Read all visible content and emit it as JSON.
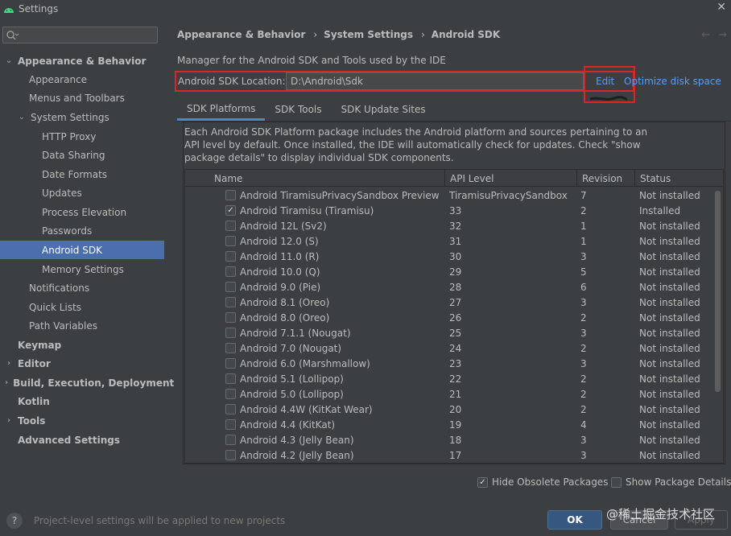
{
  "window": {
    "title": "Settings",
    "close": "✕"
  },
  "sidebar": {
    "search_placeholder": "",
    "items": [
      {
        "label": "Appearance & Behavior",
        "bold": true,
        "arrow": "⌄",
        "indent": 6
      },
      {
        "label": "Appearance",
        "indent": 36
      },
      {
        "label": "Menus and Toolbars",
        "indent": 36
      },
      {
        "label": "System Settings",
        "arrow": "⌄",
        "indent": 22
      },
      {
        "label": "HTTP Proxy",
        "indent": 52
      },
      {
        "label": "Data Sharing",
        "indent": 52
      },
      {
        "label": "Date Formats",
        "indent": 52
      },
      {
        "label": "Updates",
        "indent": 52
      },
      {
        "label": "Process Elevation",
        "indent": 52
      },
      {
        "label": "Passwords",
        "indent": 52
      },
      {
        "label": "Android SDK",
        "indent": 52,
        "selected": true
      },
      {
        "label": "Memory Settings",
        "indent": 52
      },
      {
        "label": "Notifications",
        "indent": 36
      },
      {
        "label": "Quick Lists",
        "indent": 36
      },
      {
        "label": "Path Variables",
        "indent": 36
      },
      {
        "label": "Keymap",
        "bold": true,
        "indent": 22
      },
      {
        "label": "Editor",
        "bold": true,
        "arrow": "›",
        "indent": 6
      },
      {
        "label": "Build, Execution, Deployment",
        "bold": true,
        "arrow": "›",
        "indent": 6
      },
      {
        "label": "Kotlin",
        "bold": true,
        "indent": 22
      },
      {
        "label": "Tools",
        "bold": true,
        "arrow": "›",
        "indent": 6
      },
      {
        "label": "Advanced Settings",
        "bold": true,
        "indent": 22
      }
    ]
  },
  "breadcrumb": {
    "part1": "Appearance & Behavior",
    "sep": "›",
    "part2": "System Settings",
    "part3": "Android SDK",
    "back": "←",
    "forward": "→"
  },
  "description": "Manager for the Android SDK and Tools used by the IDE",
  "sdk_location": {
    "label": "Android SDK Location:",
    "value": "D:\\Android\\Sdk",
    "edit": "Edit",
    "optimize": "Optimize disk space"
  },
  "tabs": [
    "SDK Platforms",
    "SDK Tools",
    "SDK Update Sites"
  ],
  "panel": {
    "description": "Each Android SDK Platform package includes the Android platform and sources pertaining to an API level by default. Once installed, the IDE will automatically check for updates. Check \"show package details\" to display individual SDK components.",
    "columns": [
      "Name",
      "API Level",
      "Revision",
      "Status"
    ],
    "rows": [
      {
        "name": "Android TiramisuPrivacySandbox Preview",
        "api": "TiramisuPrivacySandbox",
        "rev": "7",
        "status": "Not installed",
        "checked": false
      },
      {
        "name": "Android Tiramisu (Tiramisu)",
        "api": "33",
        "rev": "2",
        "status": "Installed",
        "checked": true
      },
      {
        "name": "Android 12L (Sv2)",
        "api": "32",
        "rev": "1",
        "status": "Not installed",
        "checked": false
      },
      {
        "name": "Android 12.0 (S)",
        "api": "31",
        "rev": "1",
        "status": "Not installed",
        "checked": false
      },
      {
        "name": "Android 11.0 (R)",
        "api": "30",
        "rev": "3",
        "status": "Not installed",
        "checked": false
      },
      {
        "name": "Android 10.0 (Q)",
        "api": "29",
        "rev": "5",
        "status": "Not installed",
        "checked": false
      },
      {
        "name": "Android 9.0 (Pie)",
        "api": "28",
        "rev": "6",
        "status": "Not installed",
        "checked": false
      },
      {
        "name": "Android 8.1 (Oreo)",
        "api": "27",
        "rev": "3",
        "status": "Not installed",
        "checked": false
      },
      {
        "name": "Android 8.0 (Oreo)",
        "api": "26",
        "rev": "2",
        "status": "Not installed",
        "checked": false
      },
      {
        "name": "Android 7.1.1 (Nougat)",
        "api": "25",
        "rev": "3",
        "status": "Not installed",
        "checked": false
      },
      {
        "name": "Android 7.0 (Nougat)",
        "api": "24",
        "rev": "2",
        "status": "Not installed",
        "checked": false
      },
      {
        "name": "Android 6.0 (Marshmallow)",
        "api": "23",
        "rev": "3",
        "status": "Not installed",
        "checked": false
      },
      {
        "name": "Android 5.1 (Lollipop)",
        "api": "22",
        "rev": "2",
        "status": "Not installed",
        "checked": false
      },
      {
        "name": "Android 5.0 (Lollipop)",
        "api": "21",
        "rev": "2",
        "status": "Not installed",
        "checked": false
      },
      {
        "name": "Android 4.4W (KitKat Wear)",
        "api": "20",
        "rev": "2",
        "status": "Not installed",
        "checked": false
      },
      {
        "name": "Android 4.4 (KitKat)",
        "api": "19",
        "rev": "4",
        "status": "Not installed",
        "checked": false
      },
      {
        "name": "Android 4.3 (Jelly Bean)",
        "api": "18",
        "rev": "3",
        "status": "Not installed",
        "checked": false
      },
      {
        "name": "Android 4.2 (Jelly Bean)",
        "api": "17",
        "rev": "3",
        "status": "Not installed",
        "checked": false
      }
    ]
  },
  "options": {
    "hide_obsolete": "Hide Obsolete Packages",
    "show_details": "Show Package Details"
  },
  "footer": {
    "help": "?",
    "note": "Project-level settings will be applied to new projects",
    "ok": "OK",
    "cancel": "Cancel",
    "apply": "Apply",
    "watermark": "@稀土掘金技术社区"
  },
  "colors": {
    "accent": "#4b6eaf",
    "link": "#589df6",
    "highlight": "#e02424"
  }
}
